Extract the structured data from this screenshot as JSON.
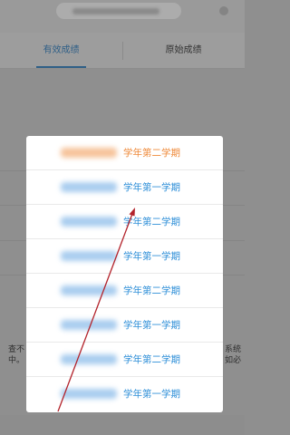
{
  "background": {
    "tabs": {
      "effective": "有效成绩",
      "original": "原始成绩"
    },
    "left_text": "查不\n中。",
    "right_text": "系统\n如必"
  },
  "semester_picker": {
    "selected_index": 0,
    "items": [
      {
        "label": "学年第二学期"
      },
      {
        "label": "学年第一学期"
      },
      {
        "label": "学年第二学期"
      },
      {
        "label": "学年第一学期"
      },
      {
        "label": "学年第二学期"
      },
      {
        "label": "学年第一学期"
      },
      {
        "label": "学年第二学期"
      },
      {
        "label": "学年第一学期"
      }
    ]
  },
  "colors": {
    "accent_blue": "#2f8fd8",
    "selected_orange": "#ef8a3a",
    "arrow": "#b3232b"
  }
}
